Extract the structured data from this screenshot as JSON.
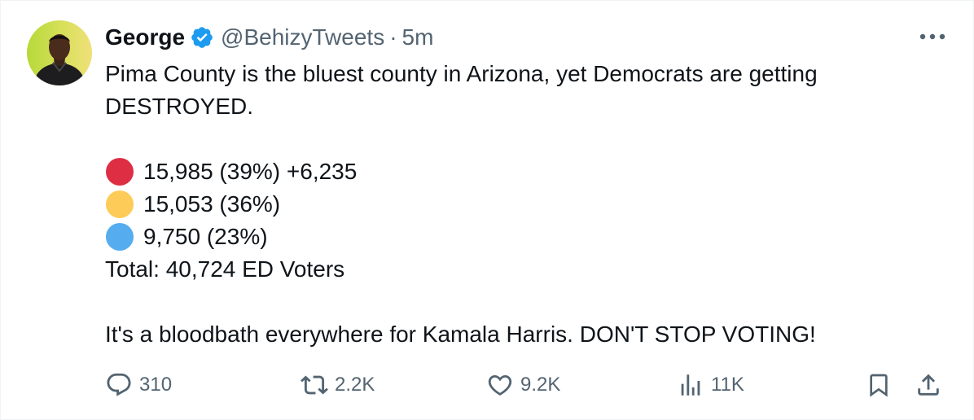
{
  "author": {
    "name": "George",
    "handle": "@BehizyTweets",
    "separator": "·",
    "time": "5m",
    "verified": true
  },
  "tweet": {
    "line1": "Pima County is the bluest county in Arizona, yet Democrats are getting",
    "line2": "DESTROYED.",
    "results": [
      {
        "color": "#dd2e44",
        "text": "15,985 (39%) +6,235"
      },
      {
        "color": "#fdcb58",
        "text": "15,053 (36%)"
      },
      {
        "color": "#55acee",
        "text": "9,750 (23%)"
      }
    ],
    "total": "Total: 40,724 ED Voters",
    "closing": "It's a bloodbath everywhere for Kamala Harris. DON'T STOP VOTING!"
  },
  "actions": {
    "replies": "310",
    "retweets": "2.2K",
    "likes": "9.2K",
    "views": "11K"
  },
  "colors": {
    "verified_blue": "#1d9bf0",
    "muted": "#536471",
    "text": "#0f1419"
  },
  "icons": {
    "more": "more-dots-icon",
    "reply": "reply-bubble-icon",
    "retweet": "retweet-icon",
    "like": "heart-icon",
    "views": "analytics-bars-icon",
    "bookmark": "bookmark-icon",
    "share": "share-upload-icon"
  }
}
